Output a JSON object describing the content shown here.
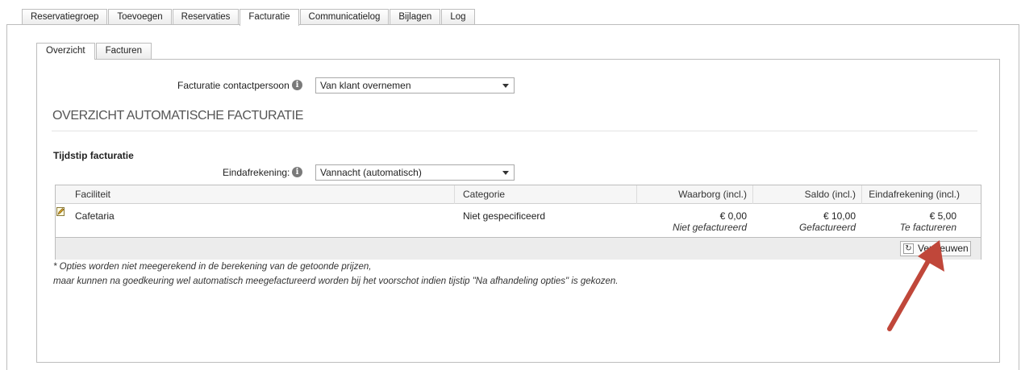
{
  "top_tabs": [
    {
      "label": "Reservatiegroep"
    },
    {
      "label": "Toevoegen"
    },
    {
      "label": "Reservaties"
    },
    {
      "label": "Facturatie",
      "active": true
    },
    {
      "label": "Communicatielog"
    },
    {
      "label": "Bijlagen"
    },
    {
      "label": "Log"
    }
  ],
  "sub_tabs": [
    {
      "label": "Overzicht",
      "active": true
    },
    {
      "label": "Facturen"
    }
  ],
  "contact": {
    "label": "Facturatie contactpersoon",
    "value": "Van klant overnemen"
  },
  "section_title": "OVERZICHT AUTOMATISCHE FACTURATIE",
  "timing": {
    "heading": "Tijdstip facturatie",
    "label": "Eindafrekening:",
    "value": "Vannacht (automatisch)"
  },
  "table": {
    "columns": [
      "Faciliteit",
      "Categorie",
      "Waarborg (incl.)",
      "Saldo (incl.)",
      "Eindafrekening (incl.)"
    ],
    "rows": [
      {
        "faciliteit": "Cafetaria",
        "categorie": "Niet gespecificeerd",
        "waarborg": "€ 0,00",
        "waarborg_status": "Niet gefactureerd",
        "saldo": "€ 10,00",
        "saldo_status": "Gefactureerd",
        "eindafrekening": "€ 5,00",
        "eindafrekening_status": "Te factureren"
      }
    ],
    "refresh_label": "Vernieuwen"
  },
  "notes": [
    "* Opties worden niet meegerekend in de berekening van de getoonde prijzen,",
    "maar kunnen na goedkeuring wel automatisch meegefactureerd worden bij het voorschot indien tijstip \"Na afhandeling opties\" is gekozen."
  ],
  "colors": {
    "annotation_arrow": "#c0473a",
    "tab_border": "#bdbdbd",
    "info_icon": "#7a7a7a"
  },
  "icons": {
    "info": "info-icon",
    "edit": "pencil-icon",
    "refresh": "refresh-icon",
    "dropdown": "chevron-down-icon"
  }
}
